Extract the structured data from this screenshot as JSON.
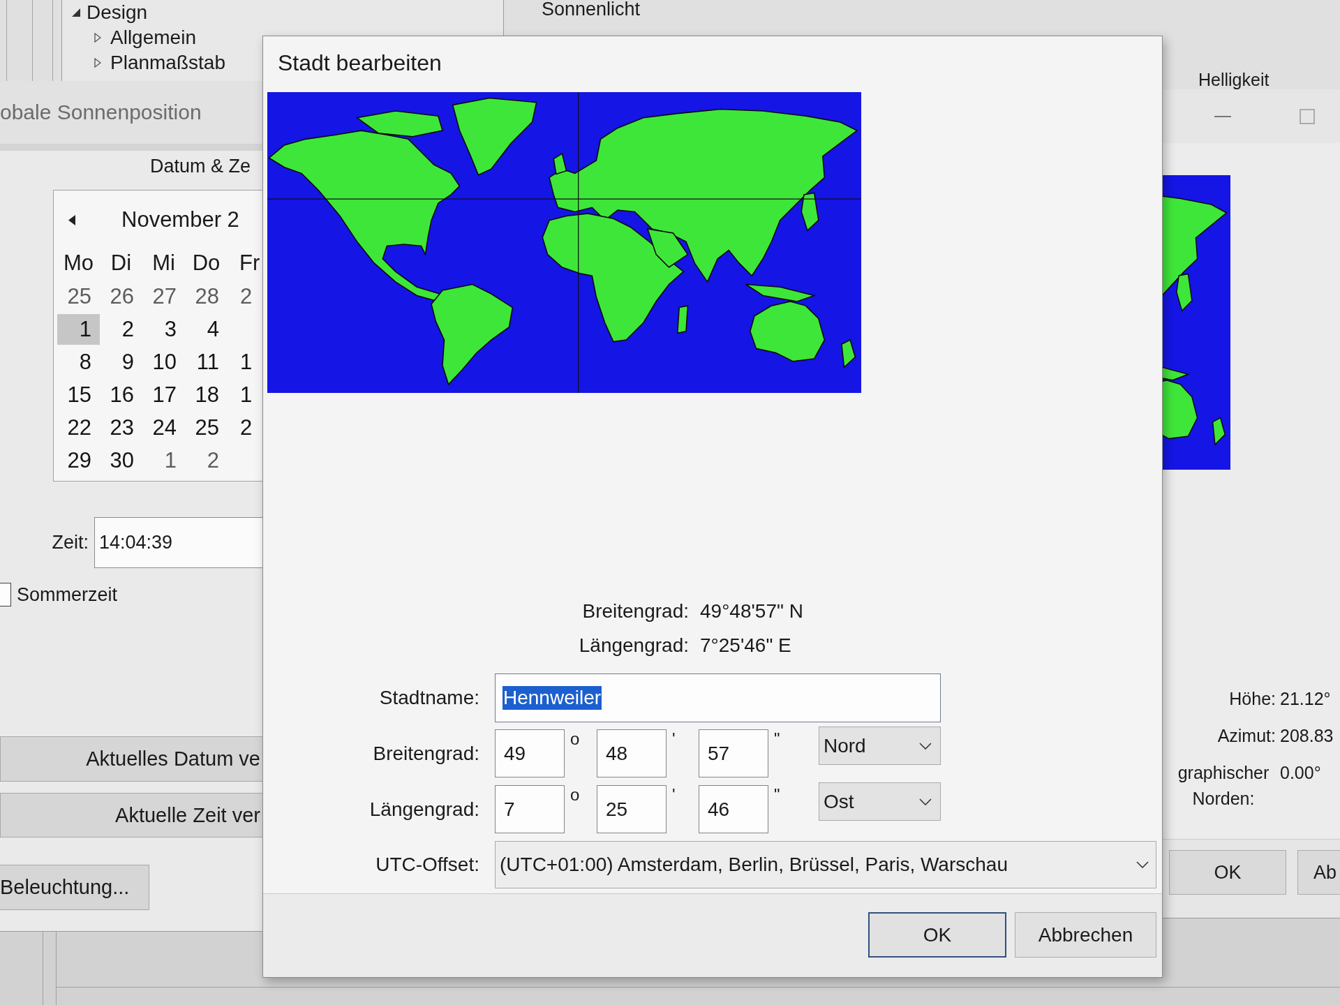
{
  "main_window": {
    "tree": [
      {
        "label": "Design",
        "expanded": true,
        "children": [
          {
            "label": "Allgemein",
            "expanded": false
          },
          {
            "label": "Planmaßstab",
            "expanded": false
          }
        ]
      }
    ],
    "section_title": "Sonnenlicht",
    "column_header": "Helligkeit"
  },
  "sun_position_window": {
    "title": "obale Sonnenposition",
    "group_title": "Datum & Ze",
    "calendar": {
      "month": "November 2",
      "weekdays": [
        "Mo",
        "Di",
        "Mi",
        "Do",
        "Fr"
      ],
      "weeks": [
        [
          {
            "day": "25",
            "other_month": true,
            "selected": false
          },
          {
            "day": "26",
            "other_month": true,
            "selected": false
          },
          {
            "day": "27",
            "other_month": true,
            "selected": false
          },
          {
            "day": "28",
            "other_month": true,
            "selected": false
          },
          {
            "day": "2",
            "other_month": true,
            "selected": false
          }
        ],
        [
          {
            "day": "1",
            "other_month": false,
            "selected": true
          },
          {
            "day": "2",
            "other_month": false,
            "selected": false
          },
          {
            "day": "3",
            "other_month": false,
            "selected": false
          },
          {
            "day": "4",
            "other_month": false,
            "selected": false
          }
        ],
        [
          {
            "day": "8",
            "other_month": false,
            "selected": false
          },
          {
            "day": "9",
            "other_month": false,
            "selected": false
          },
          {
            "day": "10",
            "other_month": false,
            "selected": false
          },
          {
            "day": "11",
            "other_month": false,
            "selected": false
          },
          {
            "day": "1",
            "other_month": false,
            "selected": false
          }
        ],
        [
          {
            "day": "15",
            "other_month": false,
            "selected": false
          },
          {
            "day": "16",
            "other_month": false,
            "selected": false
          },
          {
            "day": "17",
            "other_month": false,
            "selected": false
          },
          {
            "day": "18",
            "other_month": false,
            "selected": false
          },
          {
            "day": "1",
            "other_month": false,
            "selected": false
          }
        ],
        [
          {
            "day": "22",
            "other_month": false,
            "selected": false
          },
          {
            "day": "23",
            "other_month": false,
            "selected": false
          },
          {
            "day": "24",
            "other_month": false,
            "selected": false
          },
          {
            "day": "25",
            "other_month": false,
            "selected": false
          },
          {
            "day": "2",
            "other_month": false,
            "selected": false
          }
        ],
        [
          {
            "day": "29",
            "other_month": false,
            "selected": false
          },
          {
            "day": "30",
            "other_month": false,
            "selected": false
          },
          {
            "day": "1",
            "other_month": true,
            "selected": false
          },
          {
            "day": "2",
            "other_month": true,
            "selected": false
          }
        ]
      ]
    },
    "time": {
      "label": "Zeit:",
      "value": "14:04:39"
    },
    "daylight_saving": {
      "label": "Sommerzeit",
      "checked": false
    },
    "buttons": [
      "Aktuelles Datum ve",
      "Aktuelle Zeit ver",
      "Beleuchtung..."
    ]
  },
  "sun_info_window": {
    "readings": [
      {
        "label": "Höhe:",
        "value": "21.12°"
      },
      {
        "label": "Azimut:",
        "value": "208.83"
      },
      {
        "label": "graphischer Norden:",
        "value": "0.00°"
      }
    ],
    "buttons": [
      "OK",
      "Ab"
    ]
  },
  "city_dialog": {
    "title": "Stadt bearbeiten",
    "coordinates": [
      {
        "label": "Breitengrad:",
        "value": "49°48'57\" N"
      },
      {
        "label": "Längengrad:",
        "value": "7°25'46\" E"
      }
    ],
    "city_name": {
      "label": "Stadtname:",
      "value": "Hennweiler",
      "text_selected": true
    },
    "latitude": {
      "label": "Breitengrad:",
      "parts": [
        {
          "value": "49",
          "unit": "o"
        },
        {
          "value": "48",
          "unit": "'"
        },
        {
          "value": "57",
          "unit": "\""
        }
      ],
      "hemisphere": "Nord"
    },
    "longitude": {
      "label": "Längengrad:",
      "parts": [
        {
          "value": "7",
          "unit": "o"
        },
        {
          "value": "25",
          "unit": "'"
        },
        {
          "value": "46",
          "unit": "\""
        }
      ],
      "hemisphere": "Ost"
    },
    "utc_offset": {
      "label": "UTC-Offset:",
      "value": "(UTC+01:00) Amsterdam, Berlin, Brüssel, Paris, Warschau"
    },
    "buttons": [
      {
        "label": "OK",
        "default": true
      },
      {
        "label": "Abbrechen",
        "default": false
      }
    ]
  }
}
